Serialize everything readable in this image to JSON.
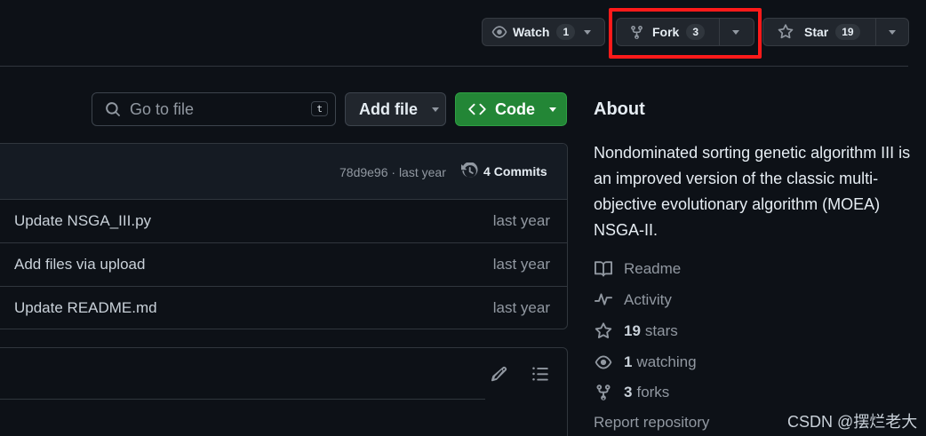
{
  "header": {
    "watch": {
      "label": "Watch",
      "count": "1"
    },
    "fork": {
      "label": "Fork",
      "count": "3"
    },
    "star": {
      "label": "Star",
      "count": "19"
    }
  },
  "toolbar": {
    "search_placeholder": "Go to file",
    "search_shortcut": "t",
    "add_file_label": "Add file",
    "code_label": "Code"
  },
  "commit_bar": {
    "hash_time": "78d9e96 · last year",
    "commits_count": "4",
    "commits_label": "Commits"
  },
  "files": [
    {
      "message": "Update NSGA_III.py",
      "time": "last year"
    },
    {
      "message": "Add files via upload",
      "time": "last year"
    },
    {
      "message": "Update README.md",
      "time": "last year"
    }
  ],
  "about": {
    "title": "About",
    "description": "Nondominated sorting genetic algorithm III is an improved version of the classic multi-objective evolutionary algorithm (MOEA) NSGA-II.",
    "readme": "Readme",
    "activity": "Activity",
    "stars_count": "19",
    "stars_label": "stars",
    "watching_count": "1",
    "watching_label": "watching",
    "forks_count": "3",
    "forks_label": "forks",
    "report": "Report repository"
  },
  "watermark": "CSDN @摆烂老大",
  "colors": {
    "background": "#0d1117",
    "code_button": "#238636",
    "highlight": "#ff1a1a"
  }
}
